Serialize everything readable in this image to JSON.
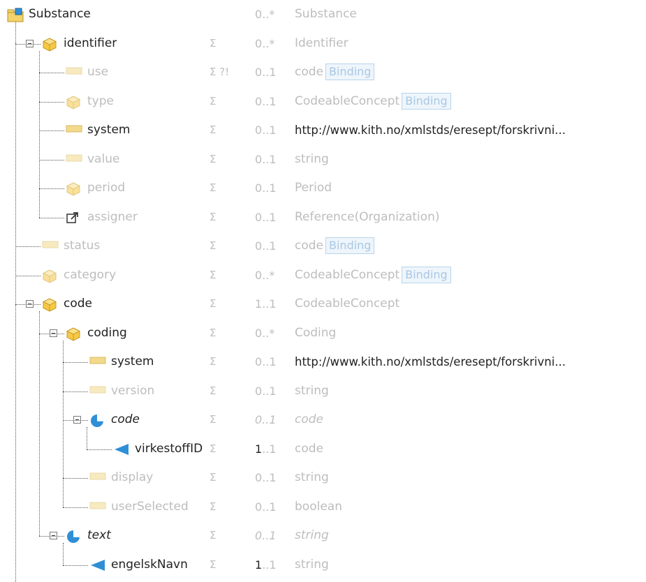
{
  "colors": {
    "element_icon": "#f2d98c",
    "complex_icon": "#f5c445",
    "slice_icon": "#2f8fd6",
    "binding_bg": "#eef5fb",
    "binding_text": "#a9c8e4"
  },
  "rows": [
    {
      "label": "Substance",
      "flags": "",
      "card_min": "0",
      "card_max": "..*",
      "type": "Substance",
      "binding": "",
      "icon": "folder-icon",
      "dim": false,
      "italic": false,
      "toggle": false,
      "bold_card": false,
      "active_type": false
    },
    {
      "label": "identifier",
      "flags": "Σ",
      "card_min": "0",
      "card_max": "..*",
      "type": "Identifier",
      "binding": "",
      "icon": "datatype-icon",
      "dim": false,
      "italic": false,
      "toggle": true,
      "bold_card": false,
      "active_type": false
    },
    {
      "label": "use",
      "flags": "Σ ?!",
      "card_min": "0",
      "card_max": "..1",
      "type": "code",
      "binding": "Binding",
      "icon": "element-icon",
      "dim": true,
      "italic": false,
      "toggle": false,
      "bold_card": false,
      "active_type": false
    },
    {
      "label": "type",
      "flags": "Σ",
      "card_min": "0",
      "card_max": "..1",
      "type": "CodeableConcept",
      "binding": "Binding",
      "icon": "datatype-icon",
      "dim": true,
      "italic": false,
      "toggle": false,
      "bold_card": false,
      "active_type": false
    },
    {
      "label": "system",
      "flags": "Σ",
      "card_min": "0",
      "card_max": "..1",
      "type": "http://www.kith.no/xmlstds/eresept/forskrivni...",
      "binding": "",
      "icon": "element-icon",
      "dim": false,
      "italic": false,
      "toggle": false,
      "bold_card": false,
      "active_type": true
    },
    {
      "label": "value",
      "flags": "Σ",
      "card_min": "0",
      "card_max": "..1",
      "type": "string",
      "binding": "",
      "icon": "element-icon",
      "dim": true,
      "italic": false,
      "toggle": false,
      "bold_card": false,
      "active_type": false
    },
    {
      "label": "period",
      "flags": "Σ",
      "card_min": "0",
      "card_max": "..1",
      "type": "Period",
      "binding": "",
      "icon": "datatype-icon",
      "dim": true,
      "italic": false,
      "toggle": false,
      "bold_card": false,
      "active_type": false
    },
    {
      "label": "assigner",
      "flags": "Σ",
      "card_min": "0",
      "card_max": "..1",
      "type": "Reference(Organization)",
      "binding": "",
      "icon": "reference-icon",
      "dim": true,
      "italic": false,
      "toggle": false,
      "bold_card": false,
      "active_type": false
    },
    {
      "label": "status",
      "flags": "Σ",
      "card_min": "0",
      "card_max": "..1",
      "type": "code",
      "binding": "Binding",
      "icon": "element-icon",
      "dim": true,
      "italic": false,
      "toggle": false,
      "bold_card": false,
      "active_type": false
    },
    {
      "label": "category",
      "flags": "Σ",
      "card_min": "0",
      "card_max": "..*",
      "type": "CodeableConcept",
      "binding": "Binding",
      "icon": "datatype-icon",
      "dim": true,
      "italic": false,
      "toggle": false,
      "bold_card": false,
      "active_type": false
    },
    {
      "label": "code",
      "flags": "Σ",
      "card_min": "1",
      "card_max": "..1",
      "type": "CodeableConcept",
      "binding": "",
      "icon": "datatype-icon",
      "dim": false,
      "italic": false,
      "toggle": true,
      "bold_card": false,
      "active_type": false
    },
    {
      "label": "coding",
      "flags": "Σ",
      "card_min": "0",
      "card_max": "..*",
      "type": "Coding",
      "binding": "",
      "icon": "datatype-icon",
      "dim": false,
      "italic": false,
      "toggle": true,
      "bold_card": false,
      "active_type": false
    },
    {
      "label": "system",
      "flags": "Σ",
      "card_min": "0",
      "card_max": "..1",
      "type": "http://www.kith.no/xmlstds/eresept/forskrivni...",
      "binding": "",
      "icon": "element-icon",
      "dim": false,
      "italic": false,
      "toggle": false,
      "bold_card": false,
      "active_type": true
    },
    {
      "label": "version",
      "flags": "Σ",
      "card_min": "0",
      "card_max": "..1",
      "type": "string",
      "binding": "",
      "icon": "element-icon",
      "dim": true,
      "italic": false,
      "toggle": false,
      "bold_card": false,
      "active_type": false
    },
    {
      "label": "code",
      "flags": "Σ",
      "card_min": "0",
      "card_max": "..1",
      "type": "code",
      "binding": "",
      "icon": "slice-icon",
      "dim": false,
      "italic": true,
      "toggle": true,
      "bold_card": false,
      "active_type": false
    },
    {
      "label": "virkestoffID",
      "flags": "Σ",
      "card_min": "1",
      "card_max": "..1",
      "type": "code",
      "binding": "",
      "icon": "extension-icon",
      "dim": false,
      "italic": false,
      "toggle": false,
      "bold_card": true,
      "active_type": false
    },
    {
      "label": "display",
      "flags": "Σ",
      "card_min": "0",
      "card_max": "..1",
      "type": "string",
      "binding": "",
      "icon": "element-icon",
      "dim": true,
      "italic": false,
      "toggle": false,
      "bold_card": false,
      "active_type": false
    },
    {
      "label": "userSelected",
      "flags": "Σ",
      "card_min": "0",
      "card_max": "..1",
      "type": "boolean",
      "binding": "",
      "icon": "element-icon",
      "dim": true,
      "italic": false,
      "toggle": false,
      "bold_card": false,
      "active_type": false
    },
    {
      "label": "text",
      "flags": "Σ",
      "card_min": "0",
      "card_max": "..1",
      "type": "string",
      "binding": "",
      "icon": "slice-icon",
      "dim": false,
      "italic": true,
      "toggle": true,
      "bold_card": false,
      "active_type": false
    },
    {
      "label": "engelskNavn",
      "flags": "Σ",
      "card_min": "1",
      "card_max": "..1",
      "type": "string",
      "binding": "",
      "icon": "extension-icon",
      "dim": false,
      "italic": false,
      "toggle": false,
      "bold_card": true,
      "active_type": false
    }
  ]
}
